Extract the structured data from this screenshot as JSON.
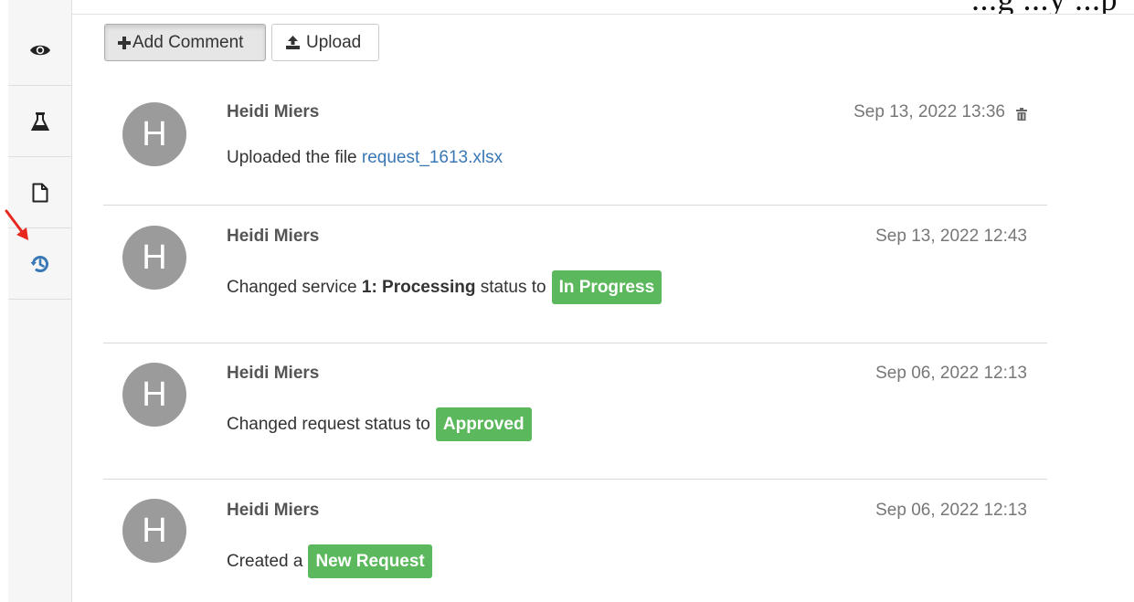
{
  "banner": {
    "text": "...g  ...y   ...p"
  },
  "sidebar": {
    "tabs": [
      {
        "icon": "eye-icon",
        "active": false
      },
      {
        "icon": "flask-icon",
        "active": false
      },
      {
        "icon": "file-icon",
        "active": false
      },
      {
        "icon": "history-icon",
        "active": true
      }
    ],
    "accent_color": "#3a78b5"
  },
  "toolbar": {
    "add_comment_label": "Add Comment",
    "upload_label": "Upload"
  },
  "feed": [
    {
      "avatar_initial": "H",
      "author": "Heidi Miers",
      "timestamp": "Sep 13, 2022 13:36",
      "has_delete": true,
      "message": {
        "prefix": "Uploaded the file ",
        "link": "request_1613.xlsx"
      }
    },
    {
      "avatar_initial": "H",
      "author": "Heidi Miers",
      "timestamp": "Sep 13, 2022 12:43",
      "message": {
        "prefix": "Changed service ",
        "strong": "1: Processing",
        "middle": " status to",
        "badge": "In Progress"
      }
    },
    {
      "avatar_initial": "H",
      "author": "Heidi Miers",
      "timestamp": "Sep 06, 2022 12:13",
      "message": {
        "prefix": "Changed request status to",
        "badge": "Approved"
      }
    },
    {
      "avatar_initial": "H",
      "author": "Heidi Miers",
      "timestamp": "Sep 06, 2022 12:13",
      "message": {
        "prefix": "Created a",
        "badge": "New Request"
      }
    }
  ],
  "colors": {
    "badge_green": "#5cb85c",
    "avatar_gray": "#9b9b9b",
    "annotation_red": "#e8281e"
  }
}
